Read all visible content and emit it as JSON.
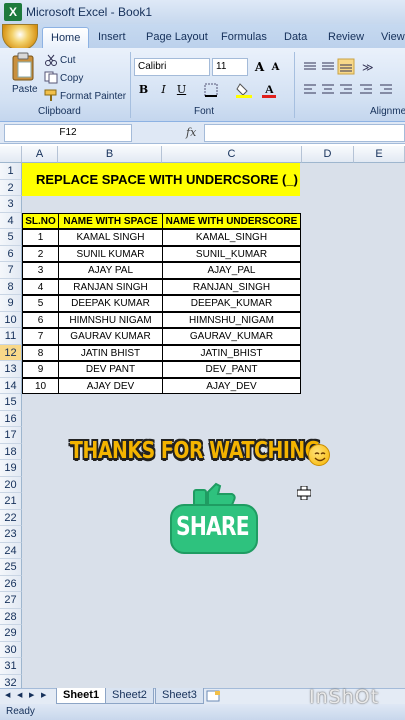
{
  "window": {
    "title": "Microsoft Excel - Book1"
  },
  "tabs": [
    "Home",
    "Insert",
    "Page Layout",
    "Formulas",
    "Data",
    "Review",
    "View"
  ],
  "ribbon": {
    "clipboard": {
      "paste": "Paste",
      "cut": "Cut",
      "copy": "Copy",
      "format_painter": "Format Painter",
      "label": "Clipboard"
    },
    "font": {
      "family": "Calibri",
      "size": "11",
      "bold": "B",
      "italic": "I",
      "underline": "U",
      "grow": "A",
      "shrink": "A",
      "label": "Font"
    },
    "alignment": {
      "label": "Alignme"
    }
  },
  "formula_bar": {
    "name_box": "F12",
    "fx": "fx",
    "value": ""
  },
  "columns": [
    "A",
    "B",
    "C",
    "D",
    "E"
  ],
  "rows": [
    "1",
    "2",
    "3",
    "4",
    "5",
    "6",
    "7",
    "8",
    "9",
    "10",
    "11",
    "12",
    "13",
    "14",
    "15",
    "16",
    "17",
    "18",
    "19",
    "20",
    "21",
    "22",
    "23",
    "24",
    "25",
    "26",
    "27",
    "28",
    "29",
    "30",
    "31",
    "32"
  ],
  "selected_row": "12",
  "sheet": {
    "banner": "REPLACE SPACE WITH UNDERCSORE (_)",
    "headers": [
      "SL.NO",
      "NAME WITH SPACE",
      "NAME WITH UNDERSCORE"
    ],
    "rows": [
      [
        "1",
        "KAMAL SINGH",
        "KAMAL_SINGH"
      ],
      [
        "2",
        "SUNIL KUMAR",
        "SUNIL_KUMAR"
      ],
      [
        "3",
        "AJAY PAL",
        "AJAY_PAL"
      ],
      [
        "4",
        "RANJAN SINGH",
        "RANJAN_SINGH"
      ],
      [
        "5",
        "DEEPAK KUMAR",
        "DEEPAK_KUMAR"
      ],
      [
        "6",
        "HIMNSHU NIGAM",
        "HIMNSHU_NIGAM"
      ],
      [
        "7",
        "GAURAV KUMAR",
        "GAURAV_KUMAR"
      ],
      [
        "8",
        "JATIN BHIST",
        "JATIN_BHIST"
      ],
      [
        "9",
        "DEV PANT",
        "DEV_PANT"
      ],
      [
        "10",
        "AJAY DEV",
        "AJAY_DEV"
      ]
    ]
  },
  "overlay": {
    "thanks": "THANKS FOR WATCHING",
    "share": "SHARE",
    "smiley_icon": "smiley-face-icon"
  },
  "sheet_tabs": [
    "Sheet1",
    "Sheet2",
    "Sheet3"
  ],
  "active_sheet": "Sheet1",
  "status": {
    "text": "Ready"
  },
  "watermark": "InShOt",
  "colors": {
    "highlight": "#ffff00",
    "share_green": "#2ec27e",
    "thanks_yellow": "#f4b400"
  }
}
